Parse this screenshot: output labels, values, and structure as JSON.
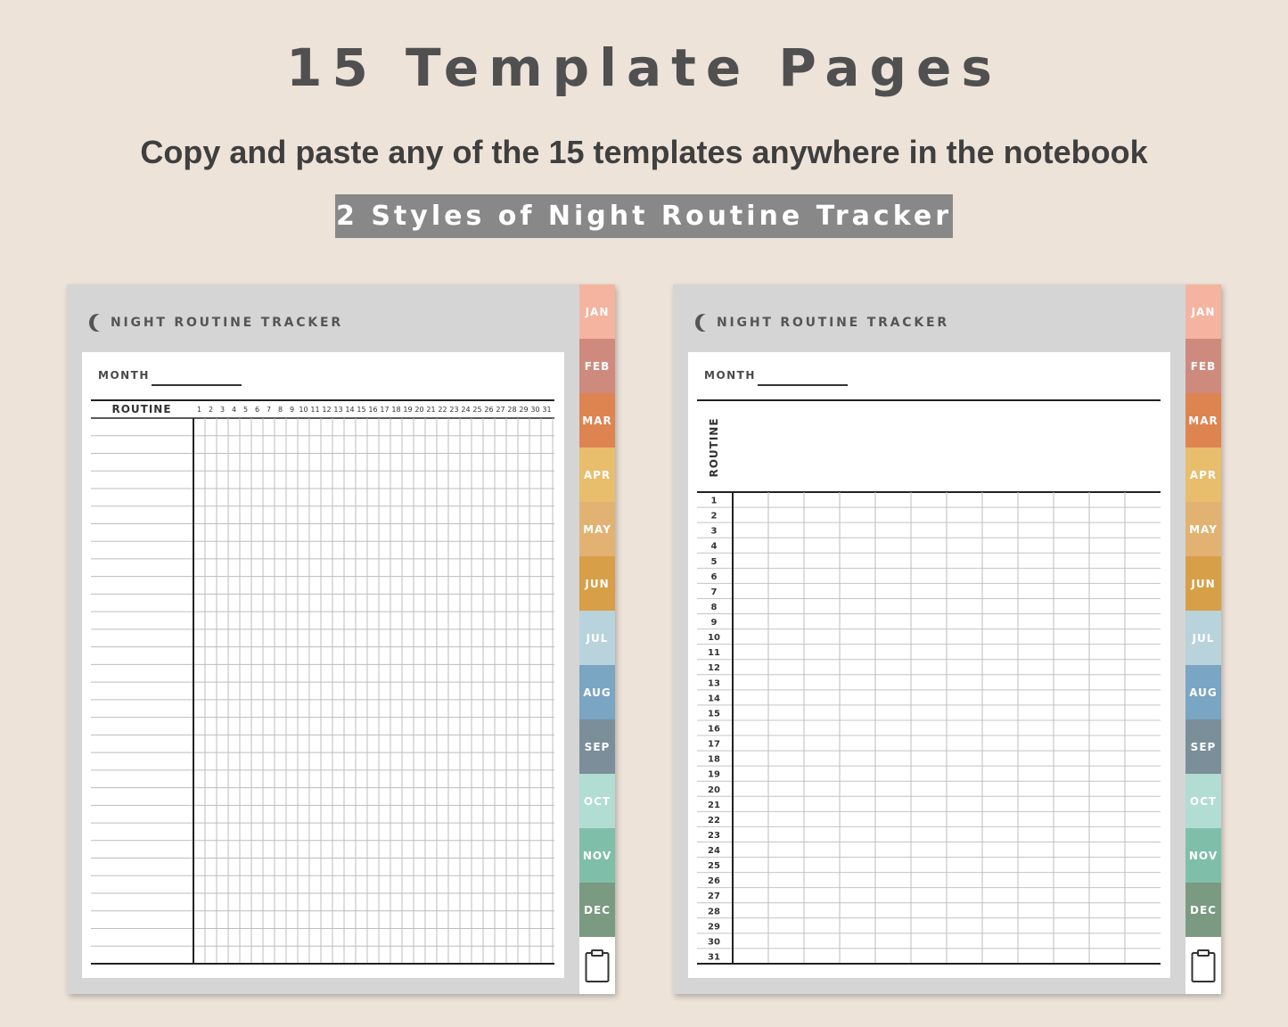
{
  "header": {
    "title": "15 Template Pages",
    "subtitle": "Copy and paste any of the 15 templates anywhere in the notebook",
    "banner": "2 Styles of Night Routine Tracker"
  },
  "pages": [
    {
      "style": "days-across",
      "title": "NIGHT ROUTINE TRACKER",
      "month_label": "MONTH",
      "routine_label": "ROUTINE",
      "day_numbers": [
        "1",
        "2",
        "3",
        "4",
        "5",
        "6",
        "7",
        "8",
        "9",
        "10",
        "11",
        "12",
        "13",
        "14",
        "15",
        "16",
        "17",
        "18",
        "19",
        "20",
        "21",
        "22",
        "23",
        "24",
        "25",
        "26",
        "27",
        "28",
        "29",
        "30",
        "31"
      ],
      "row_count": 31
    },
    {
      "style": "days-down",
      "title": "NIGHT ROUTINE TRACKER",
      "month_label": "MONTH",
      "routine_label": "ROUTINE",
      "day_numbers": [
        "1",
        "2",
        "3",
        "4",
        "5",
        "6",
        "7",
        "8",
        "9",
        "10",
        "11",
        "12",
        "13",
        "14",
        "15",
        "16",
        "17",
        "18",
        "19",
        "20",
        "21",
        "22",
        "23",
        "24",
        "25",
        "26",
        "27",
        "28",
        "29",
        "30",
        "31"
      ],
      "column_count": 12
    }
  ],
  "month_tabs": [
    {
      "label": "JAN",
      "color": "#f4b4a0"
    },
    {
      "label": "FEB",
      "color": "#cf8a7e"
    },
    {
      "label": "MAR",
      "color": "#de8451"
    },
    {
      "label": "APR",
      "color": "#e8bd6c"
    },
    {
      "label": "MAY",
      "color": "#e2b272"
    },
    {
      "label": "JUN",
      "color": "#d79f48"
    },
    {
      "label": "JUL",
      "color": "#b8d3dc"
    },
    {
      "label": "AUG",
      "color": "#7aa5c3"
    },
    {
      "label": "SEP",
      "color": "#7a8f99"
    },
    {
      "label": "OCT",
      "color": "#b2ddd2"
    },
    {
      "label": "NOV",
      "color": "#7fbfa9"
    },
    {
      "label": "DEC",
      "color": "#7b9a82"
    }
  ],
  "clipboard_icon": "clipboard-icon",
  "moon_icon": "crescent-moon-icon"
}
